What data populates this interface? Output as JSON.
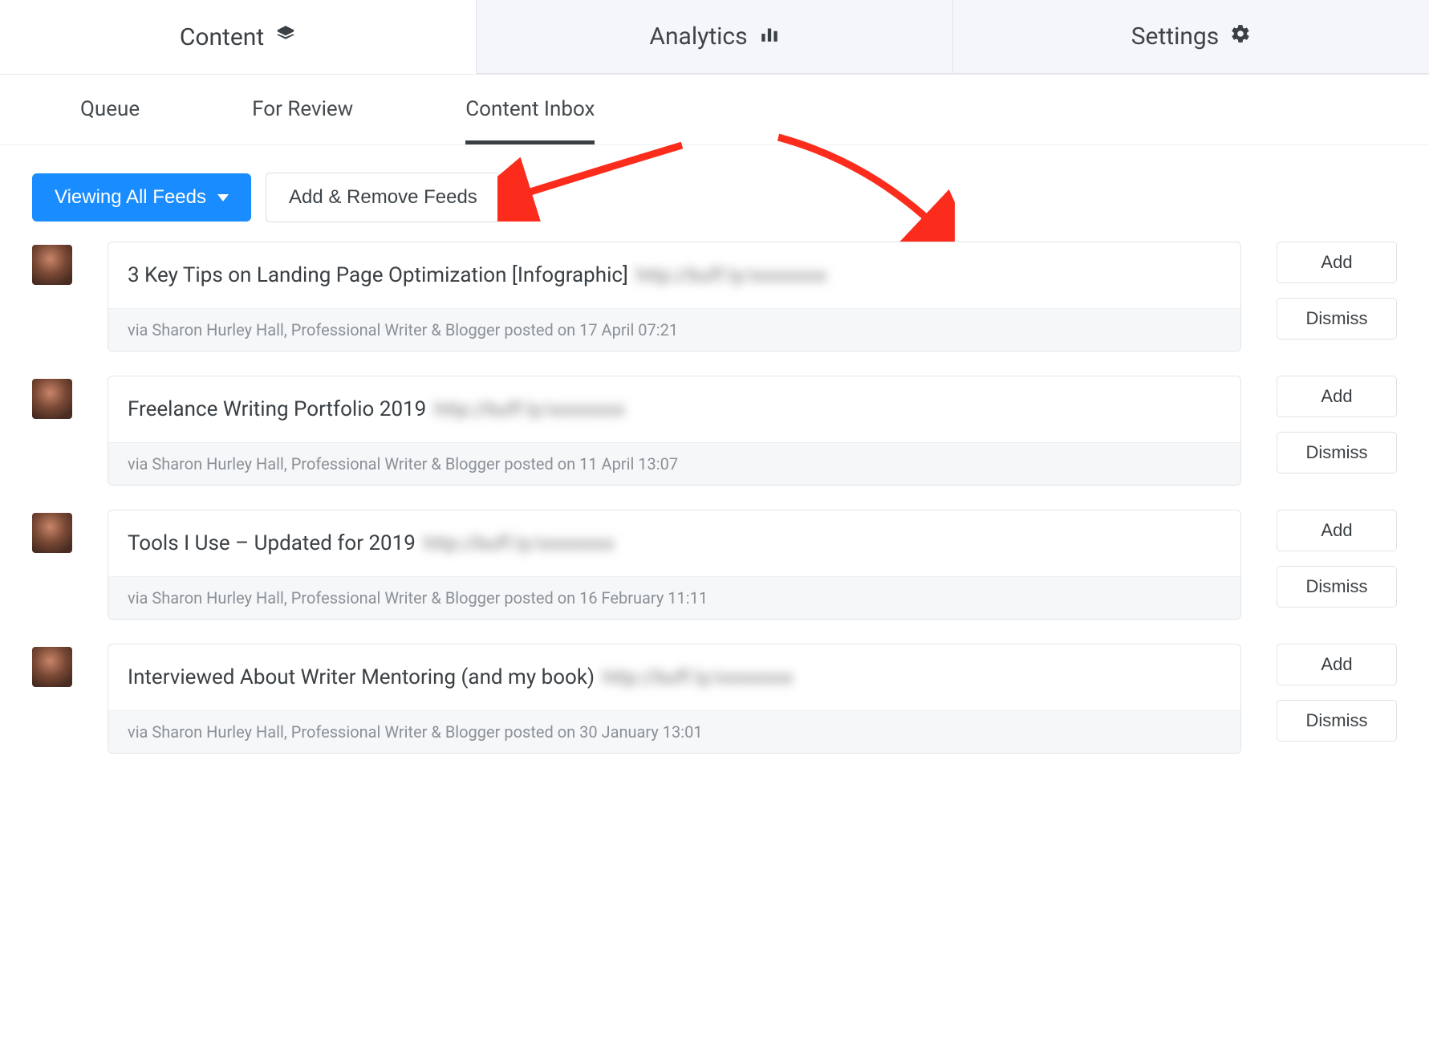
{
  "topnav": {
    "content": "Content",
    "analytics": "Analytics",
    "settings": "Settings"
  },
  "subnav": {
    "queue": "Queue",
    "for_review": "For Review",
    "content_inbox": "Content Inbox"
  },
  "controls": {
    "viewing_all_feeds": "Viewing All Feeds",
    "add_remove_feeds": "Add & Remove Feeds"
  },
  "action_labels": {
    "add": "Add",
    "dismiss": "Dismiss"
  },
  "items": [
    {
      "title": "3 Key Tips on Landing Page Optimization [Infographic]",
      "link_placeholder": "http://buff.ly/xxxxxxxx",
      "meta": "via Sharon Hurley Hall, Professional Writer & Blogger posted on 17 April 07:21"
    },
    {
      "title": "Freelance Writing Portfolio 2019",
      "link_placeholder": "http://buff.ly/xxxxxxxx",
      "meta": "via Sharon Hurley Hall, Professional Writer & Blogger posted on 11 April 13:07"
    },
    {
      "title": "Tools I Use – Updated for 2019",
      "link_placeholder": "http://buff.ly/xxxxxxxx",
      "meta": "via Sharon Hurley Hall, Professional Writer & Blogger posted on 16 February 11:11"
    },
    {
      "title": "Interviewed About Writer Mentoring (and my book)",
      "link_placeholder": "http://buff.ly/xxxxxxxx",
      "meta": "via Sharon Hurley Hall, Professional Writer & Blogger posted on 30 January 13:01"
    }
  ]
}
